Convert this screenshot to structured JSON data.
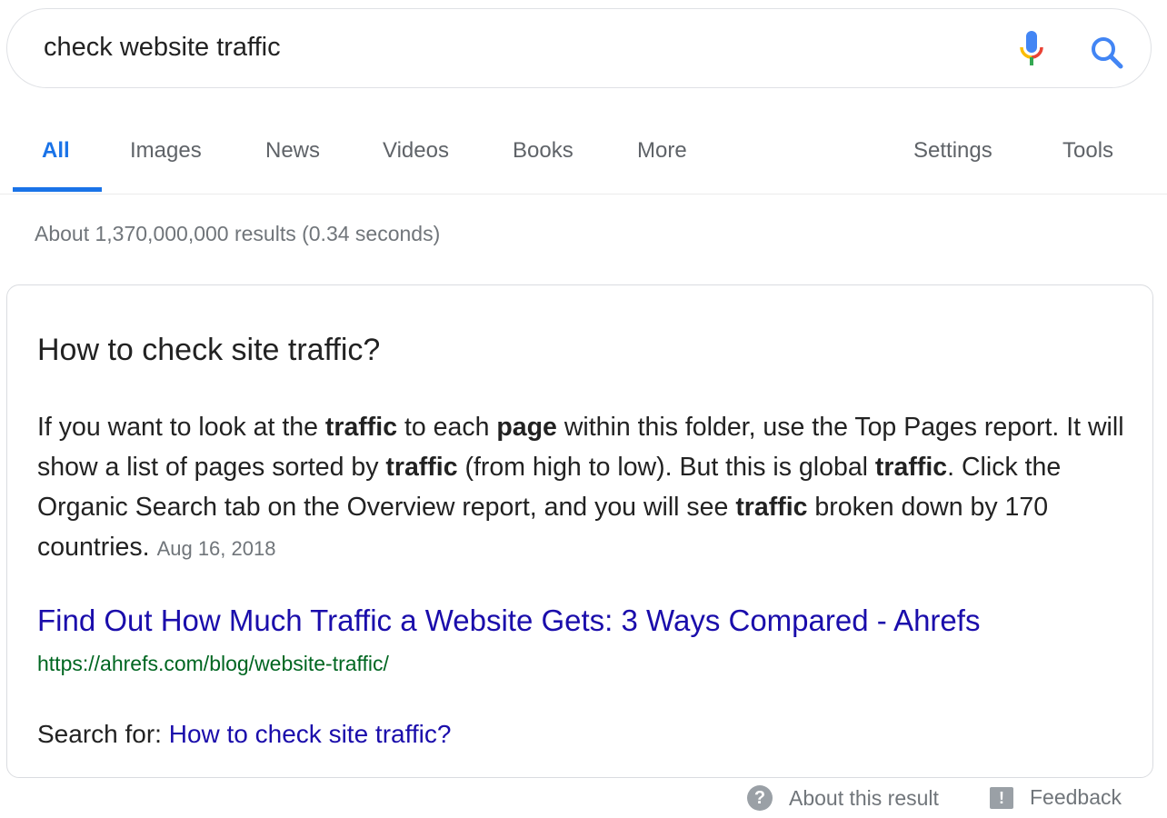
{
  "search": {
    "query": "check website traffic",
    "mic_icon": "microphone-icon",
    "search_icon": "search-icon"
  },
  "tabs": [
    {
      "label": "All",
      "active": true
    },
    {
      "label": "Images"
    },
    {
      "label": "News"
    },
    {
      "label": "Videos"
    },
    {
      "label": "Books"
    },
    {
      "label": "More"
    },
    {
      "label": "Settings"
    },
    {
      "label": "Tools"
    }
  ],
  "stats": "About 1,370,000,000 results (0.34 seconds)",
  "snippet": {
    "question": "How to check site traffic?",
    "segments": [
      {
        "text": "If you want to look at the "
      },
      {
        "text": "traffic",
        "bold": true
      },
      {
        "text": " to each "
      },
      {
        "text": "page",
        "bold": true
      },
      {
        "text": " within this folder, use the Top Pages report. It will show a list of pages sorted by "
      },
      {
        "text": "traffic",
        "bold": true
      },
      {
        "text": " (from high to low). But this is global "
      },
      {
        "text": "traffic",
        "bold": true
      },
      {
        "text": ". Click the Organic Search tab on the Overview report, and you will see "
      },
      {
        "text": "traffic",
        "bold": true
      },
      {
        "text": " broken down by 170 countries."
      }
    ],
    "date": "Aug 16, 2018",
    "link_title": "Find Out How Much Traffic a Website Gets: 3 Ways Compared - Ahrefs",
    "url": "https://ahrefs.com/blog/website-traffic/",
    "search_for_label": "Search for: ",
    "search_for_link": "How to check site traffic?"
  },
  "footer": {
    "about": "About this result",
    "feedback": "Feedback"
  },
  "colors": {
    "accent": "#1a73e8",
    "link": "#1a0dab",
    "url": "#006621"
  }
}
